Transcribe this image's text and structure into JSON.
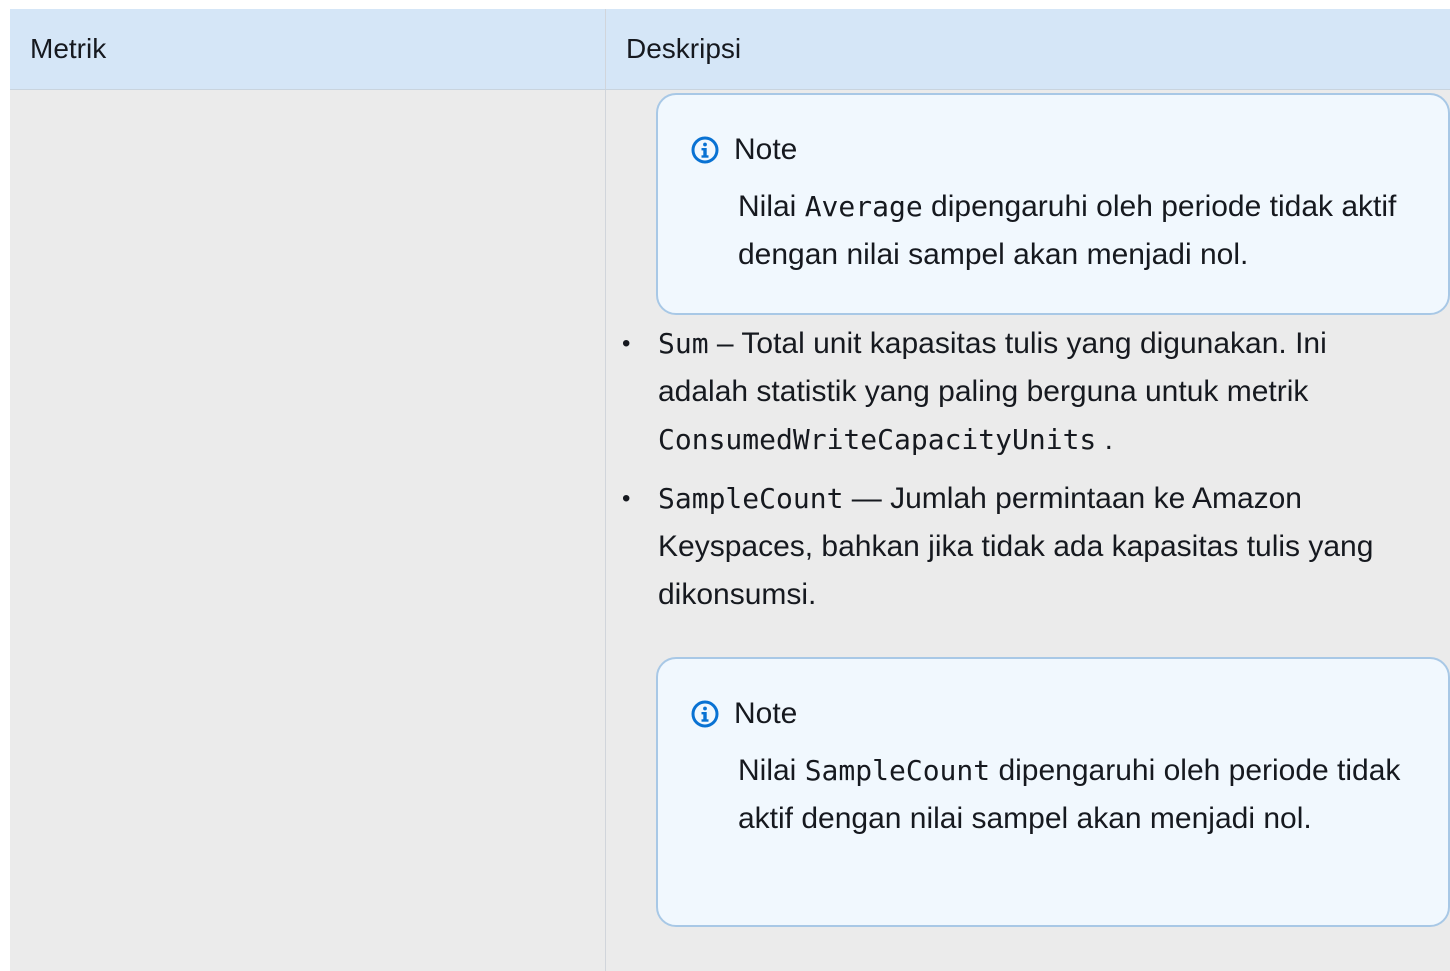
{
  "table": {
    "headers": {
      "metric": "Metrik",
      "description": "Deskripsi"
    }
  },
  "note1": {
    "title": "Note",
    "text_before": "Nilai ",
    "code": "Average",
    "text_after": " dipengaruhi oleh periode tidak aktif dengan nilai sampel akan menjadi nol."
  },
  "bullets": [
    {
      "code": "Sum",
      "text": " – Total unit kapasitas tulis yang digunakan. Ini adalah statistik yang paling berguna untuk metrik ",
      "code2": "ConsumedWriteCapacityUnits",
      "text_end": " ."
    },
    {
      "code": "SampleCount",
      "text": " — Jumlah permintaan ke Amazon Keyspaces, bahkan jika tidak ada kapasitas tulis yang dikonsumsi."
    }
  ],
  "note2": {
    "title": "Note",
    "text_before": "Nilai ",
    "code": "SampleCount",
    "text_after": " dipengaruhi oleh periode tidak aktif dengan nilai sampel akan menjadi nol."
  },
  "icons": {
    "note_icon": "info-circle-icon",
    "note_icon_color": "#0972d3"
  }
}
